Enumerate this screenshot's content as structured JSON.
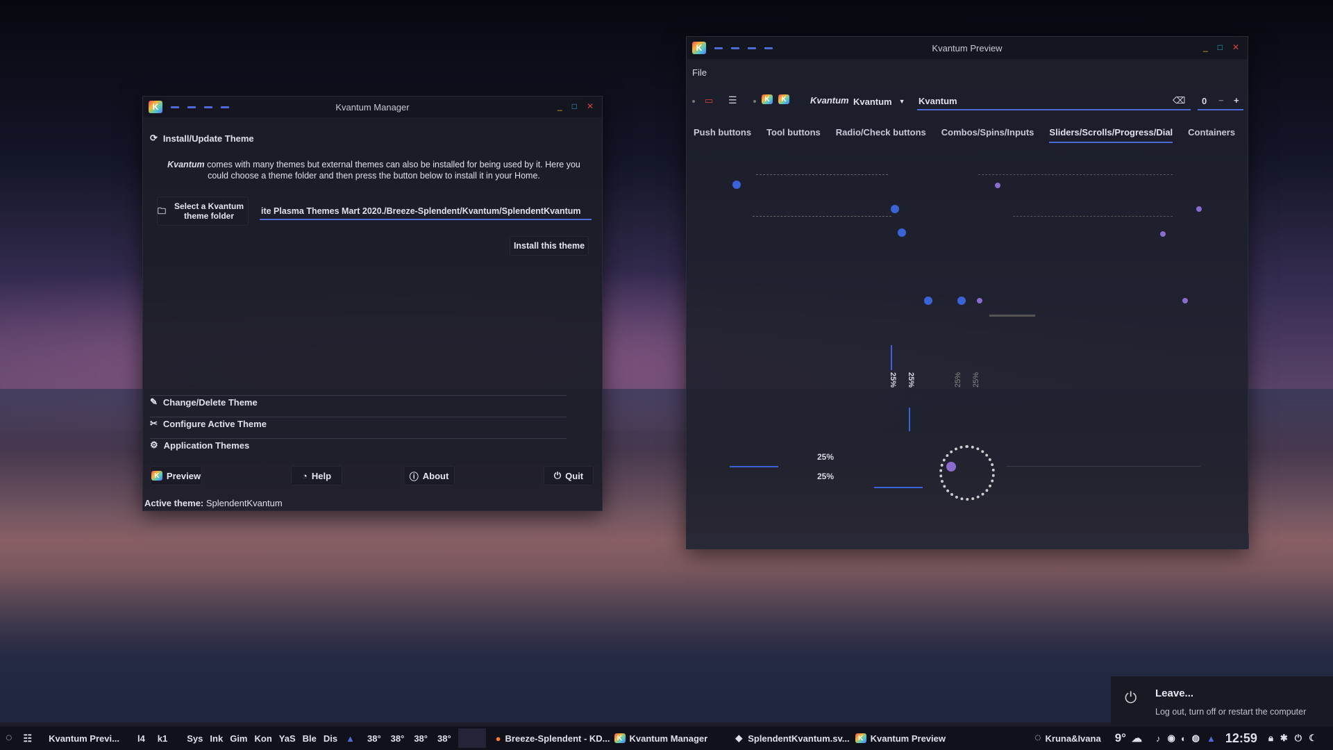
{
  "manager": {
    "title": "Kvantum Manager",
    "section_install": "Install/Update Theme",
    "intro_brand": "Kvantum",
    "intro": " comes with many themes but external themes can also be installed for being used by it. Here you could choose a theme folder and then press the button below to install it in your Home.",
    "select_folder_label": "Select a Kvantum theme folder",
    "path_value": "ite Plasma Themes Mart 2020./Breeze-Splendent/Kvantum/SplendentKvantum",
    "install_label": "Install this theme",
    "section_change": "Change/Delete Theme",
    "section_configure": "Configure Active Theme",
    "section_apps": "Application Themes",
    "preview_label": "Preview",
    "help_label": "Help",
    "about_label": "About",
    "quit_label": "Quit",
    "active_prefix": "Active theme:",
    "active_value": "SplendentKvantum"
  },
  "preview": {
    "title": "Kvantum Preview",
    "menu_file": "File",
    "toolbar_italic": "Kvantum",
    "combo_value": "Kvantum",
    "edit_value": "Kvantum",
    "spin_value": "0",
    "tabs": [
      "Push buttons",
      "Tool buttons",
      "Radio/Check buttons",
      "Combos/Spins/Inputs",
      "Sliders/Scrolls/Progress/Dial",
      "Containers"
    ],
    "active_tab": "Sliders/Scrolls/Progress/Dial",
    "vprogress": [
      "25%",
      "25%",
      "25%",
      "25%"
    ],
    "hprogress": [
      "25%",
      "25%"
    ]
  },
  "leave": {
    "title": "Leave...",
    "desc": "Log out, turn off or restart the computer"
  },
  "taskbar": {
    "tasks_short": [
      "Kvantum Previ...",
      "l4",
      "k1"
    ],
    "launchers": [
      "Sys",
      "Ink",
      "Gim",
      "Kon",
      "YaS",
      "Ble",
      "Dis"
    ],
    "temps": [
      "38°",
      "38°",
      "38°",
      "38°"
    ],
    "windows": [
      "Breeze-Splendent - KD...",
      "Kvantum Manager",
      "SplendentKvantum.sv...",
      "Kvantum Preview"
    ],
    "user": "Kruna&Ivana",
    "weather": "9°",
    "clock": "12:59"
  },
  "colors": {
    "accent": "#4f6bd6",
    "slider_handle": "#3a63d8",
    "handle_purple": "#8a6ccf",
    "close_red": "#e0413c",
    "minimize_yellow": "#e0b020",
    "maximize_cyan": "#2ab0d8"
  }
}
